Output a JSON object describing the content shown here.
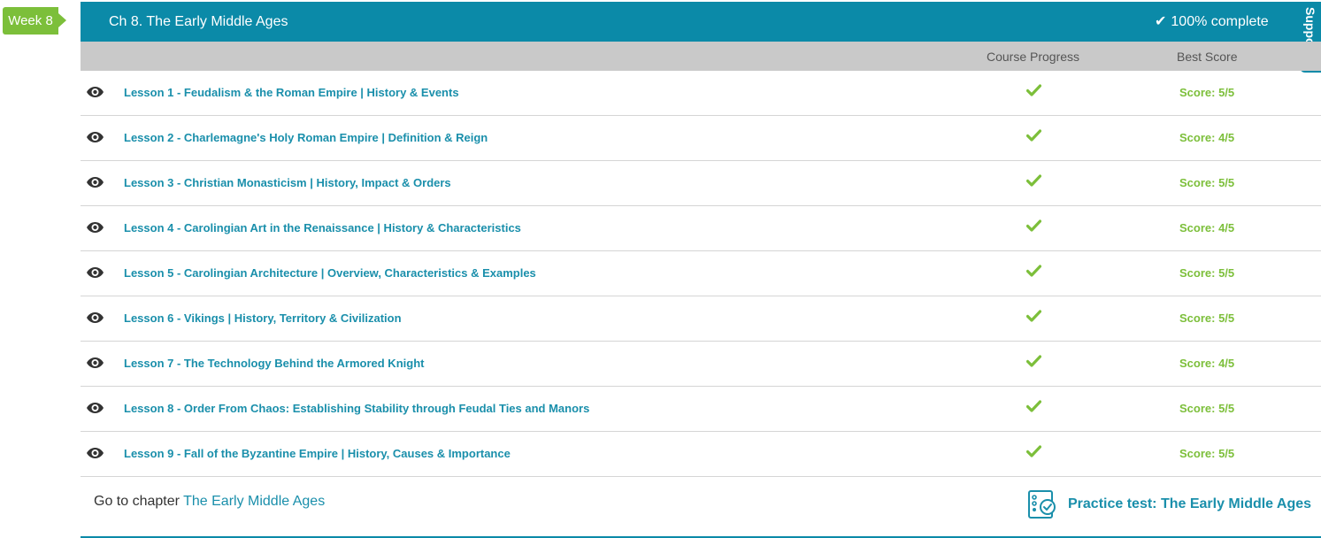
{
  "week_tag": "Week 8",
  "chapter": {
    "title": "Ch 8. The Early Middle Ages",
    "complete_text": "100% complete"
  },
  "support_tab": "Support",
  "columns": {
    "progress": "Course Progress",
    "score": "Best Score"
  },
  "lessons": [
    {
      "title": "Lesson 1 - Feudalism & the Roman Empire | History & Events",
      "score": "Score: 5/5",
      "completed": true
    },
    {
      "title": "Lesson 2 - Charlemagne's Holy Roman Empire | Definition & Reign",
      "score": "Score: 4/5",
      "completed": true
    },
    {
      "title": "Lesson 3 - Christian Monasticism | History, Impact & Orders",
      "score": "Score: 5/5",
      "completed": true
    },
    {
      "title": "Lesson 4 - Carolingian Art in the Renaissance | History & Characteristics",
      "score": "Score: 4/5",
      "completed": true
    },
    {
      "title": "Lesson 5 - Carolingian Architecture | Overview, Characteristics & Examples",
      "score": "Score: 5/5",
      "completed": true
    },
    {
      "title": "Lesson 6 - Vikings | History, Territory & Civilization",
      "score": "Score: 5/5",
      "completed": true
    },
    {
      "title": "Lesson 7 - The Technology Behind the Armored Knight",
      "score": "Score: 4/5",
      "completed": true
    },
    {
      "title": "Lesson 8 - Order From Chaos: Establishing Stability through Feudal Ties and Manors",
      "score": "Score: 5/5",
      "completed": true
    },
    {
      "title": "Lesson 9 - Fall of the Byzantine Empire | History, Causes & Importance",
      "score": "Score: 5/5",
      "completed": true
    }
  ],
  "footer": {
    "goto_prefix": "Go to chapter",
    "goto_link": "The Early Middle Ages",
    "practice_test": "Practice test: The Early Middle Ages"
  },
  "icons": {
    "view": "eye-icon",
    "progress": "checkmark-icon",
    "practice": "practice-test-icon"
  },
  "colors": {
    "header": "#0b8aa8",
    "accent_green": "#7cbf3a",
    "link": "#1a8fab",
    "column_header": "#c9c9c9"
  }
}
